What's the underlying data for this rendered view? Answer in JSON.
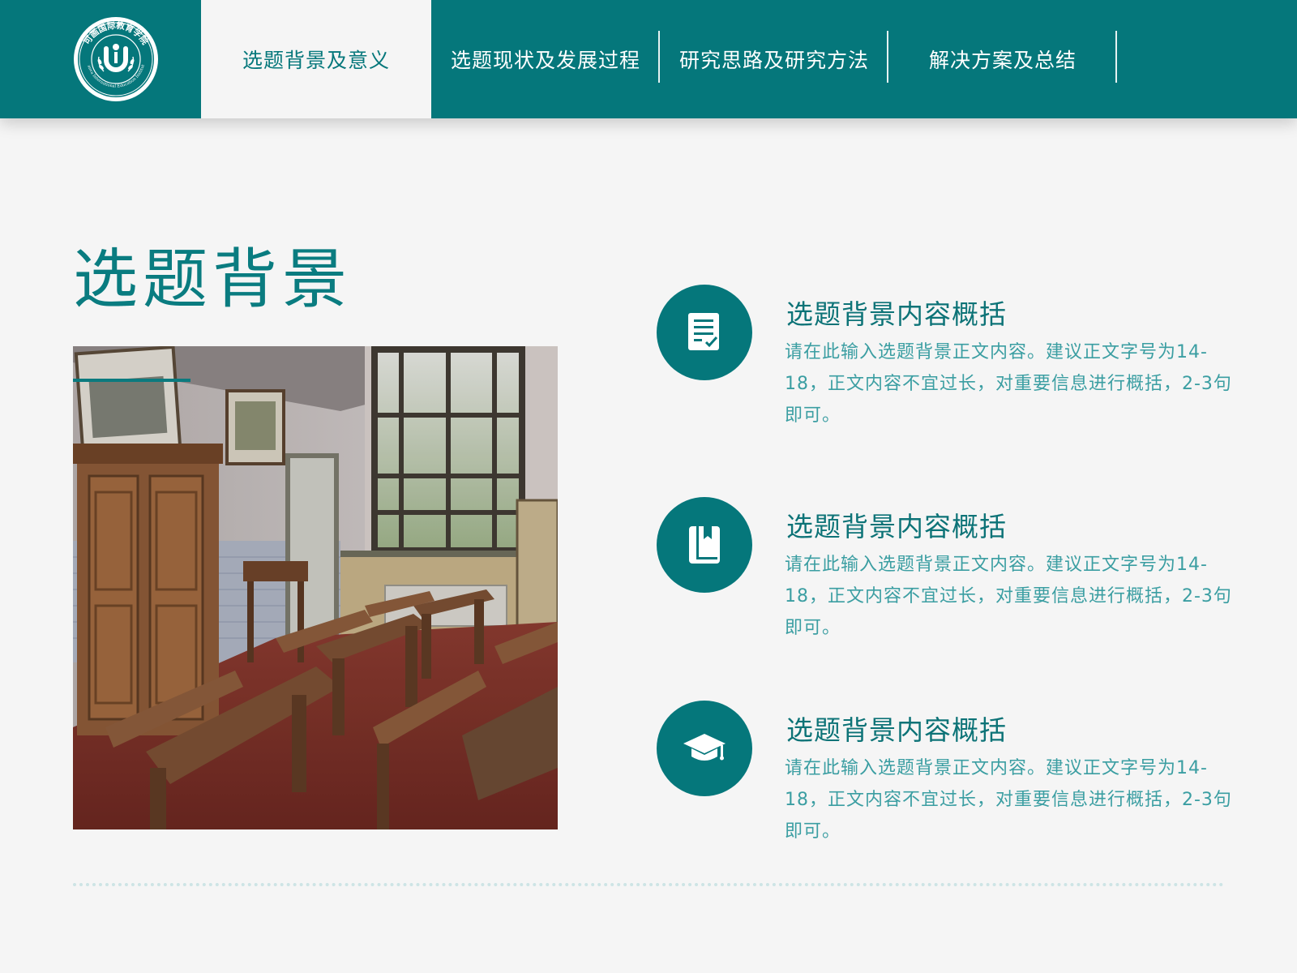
{
  "colors": {
    "brand": "#05777b",
    "background": "#f5f5f5",
    "title": "#0a7c80",
    "body_text": "#3b9ea2"
  },
  "header": {
    "logo": {
      "text_cn": "可画国际教育学院",
      "text_en": "Canva International Education Institute",
      "icon": "u-emblem-logo"
    },
    "nav": [
      {
        "label": "选题背景及意义",
        "active": true
      },
      {
        "label": "选题现状及发展过程",
        "active": false
      },
      {
        "label": "研究思路及研究方法",
        "active": false
      },
      {
        "label": "解决方案及总结",
        "active": false
      }
    ]
  },
  "main": {
    "title": "选题背景",
    "photo": {
      "subject": "vintage classroom with wooden desks"
    },
    "features": [
      {
        "icon": "document-check-icon",
        "title": "选题背景内容概括",
        "body": "请在此输入选题背景正文内容。建议正文字号为14-18，正文内容不宜过长，对重要信息进行概括，2-3句即可。"
      },
      {
        "icon": "bookmark-book-icon",
        "title": "选题背景内容概括",
        "body": "请在此输入选题背景正文内容。建议正文字号为14-18，正文内容不宜过长，对重要信息进行概括，2-3句即可。"
      },
      {
        "icon": "graduation-cap-icon",
        "title": "选题背景内容概括",
        "body": "请在此输入选题背景正文内容。建议正文字号为14-18，正文内容不宜过长，对重要信息进行概括，2-3句即可。"
      }
    ]
  }
}
